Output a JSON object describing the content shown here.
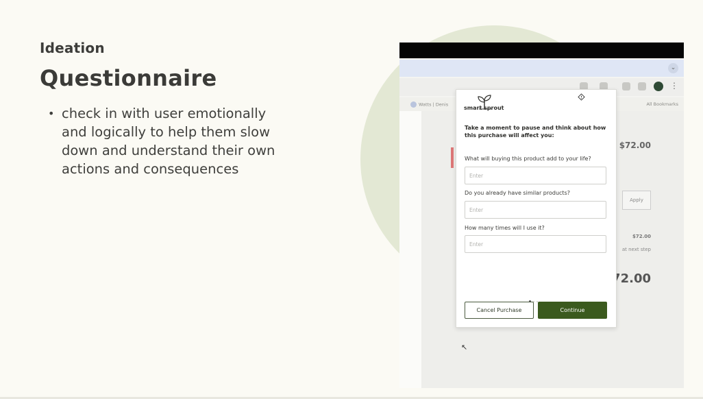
{
  "slide": {
    "eyebrow": "Ideation",
    "title": "Questionnaire",
    "bullets": [
      "check in with user emotionally and logically to help them slow down and understand their own actions and consequences"
    ]
  },
  "browser": {
    "bookmark_left": "Watts | Denis",
    "bookmark_right": "All Bookmarks"
  },
  "background_page": {
    "price": "$72.00",
    "apply_label": "Apply",
    "subtotal_value": "$72.00",
    "shipping_value": "at next step",
    "total_value": "$72.00"
  },
  "popup": {
    "brand": "smart sprout",
    "intro": "Take a moment to pause and think about how this purchase will affect you:",
    "questions": [
      {
        "label": "What will buying this product add to your life?",
        "placeholder": "Enter"
      },
      {
        "label": "Do you already have similar products?",
        "placeholder": "Enter"
      },
      {
        "label": "How many times will I use it?",
        "placeholder": "Enter"
      }
    ],
    "cancel_label": "Cancel Purchase",
    "continue_label": "Continue",
    "page_dots": 3,
    "active_dot": 1
  },
  "colors": {
    "accent": "#3b5a1e",
    "background": "#fbfaf4",
    "circle": "#e3e8d4"
  },
  "icons": [
    "sprout-icon",
    "info-diamond-icon",
    "cursor-icon",
    "chevron-down-icon",
    "more-vert-icon"
  ]
}
